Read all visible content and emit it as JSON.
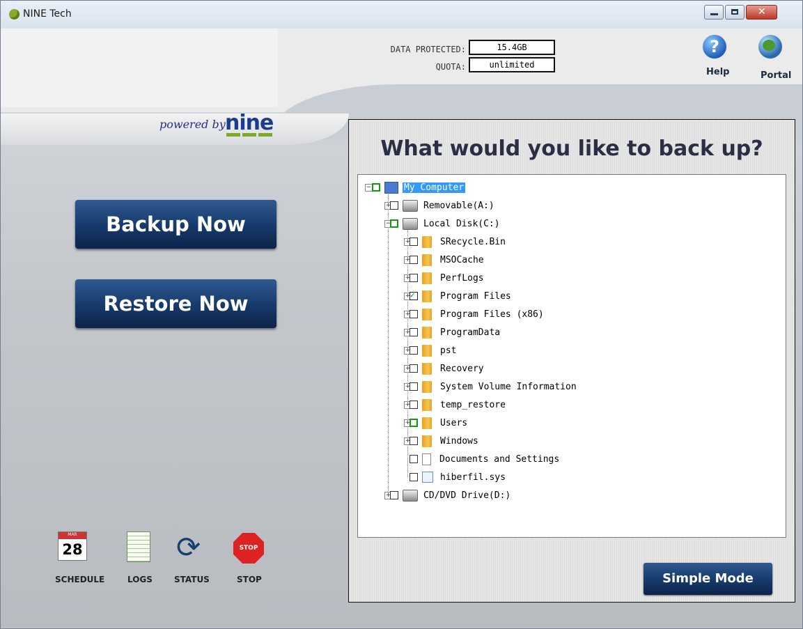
{
  "window": {
    "title": "NINE Tech",
    "close_glyph": "✕",
    "minimize_icon": "minimize-icon",
    "maximize_icon": "maximize-icon",
    "close_icon": "close-icon"
  },
  "header": {
    "powered_by": "powered by",
    "brand": "nine",
    "data_protected_label": "DATA PROTECTED:",
    "data_protected_value": "15.4GB",
    "quota_label": "QUOTA:",
    "quota_value": "unlimited",
    "help_label": "Help",
    "portal_label": "Portal",
    "help_glyph": "?",
    "help_icon": "help-icon",
    "portal_icon": "globe-icon"
  },
  "left": {
    "backup_label": "Backup Now",
    "restore_label": "Restore Now",
    "tools": [
      {
        "label": "SCHEDULE",
        "icon": "calendar-icon",
        "glyph_header": "MAR",
        "glyph_day": "28"
      },
      {
        "label": "LOGS",
        "icon": "logs-icon"
      },
      {
        "label": "STATUS",
        "icon": "refresh-icon",
        "glyph": "⟳"
      },
      {
        "label": "STOP",
        "icon": "stop-icon",
        "glyph": "STOP"
      }
    ]
  },
  "panel": {
    "title": "What would you like to back up?",
    "simple_mode_label": "Simple Mode",
    "tree": [
      {
        "label": "My Computer",
        "level": 0,
        "expander": "−",
        "check": "partial",
        "icon": "computer-icon",
        "selected": true
      },
      {
        "label": "Removable(A:)",
        "level": 1,
        "expander": "+",
        "check": "none",
        "icon": "removable-drive-icon"
      },
      {
        "label": "Local Disk(C:)",
        "level": 1,
        "expander": "−",
        "check": "partial",
        "icon": "local-disk-icon"
      },
      {
        "label": "SRecycle.Bin",
        "level": 2,
        "expander": "+",
        "check": "none",
        "icon": "folder-icon"
      },
      {
        "label": "MSOCache",
        "level": 2,
        "expander": "+",
        "check": "none",
        "icon": "folder-icon"
      },
      {
        "label": "PerfLogs",
        "level": 2,
        "expander": "+",
        "check": "none",
        "icon": "folder-icon"
      },
      {
        "label": "Program Files",
        "level": 2,
        "expander": "+",
        "check": "checked",
        "icon": "folder-icon"
      },
      {
        "label": "Program Files (x86)",
        "level": 2,
        "expander": "+",
        "check": "none",
        "icon": "folder-icon"
      },
      {
        "label": "ProgramData",
        "level": 2,
        "expander": "+",
        "check": "none",
        "icon": "folder-icon"
      },
      {
        "label": "pst",
        "level": 2,
        "expander": "+",
        "check": "none",
        "icon": "folder-icon"
      },
      {
        "label": "Recovery",
        "level": 2,
        "expander": "+",
        "check": "none",
        "icon": "folder-icon"
      },
      {
        "label": "System Volume Information",
        "level": 2,
        "expander": "+",
        "check": "none",
        "icon": "folder-icon"
      },
      {
        "label": "temp_restore",
        "level": 2,
        "expander": "+",
        "check": "none",
        "icon": "folder-icon"
      },
      {
        "label": "Users",
        "level": 2,
        "expander": "+",
        "check": "partial",
        "icon": "folder-icon"
      },
      {
        "label": "Windows",
        "level": 2,
        "expander": "+",
        "check": "none",
        "icon": "folder-icon"
      },
      {
        "label": "Documents and Settings",
        "level": 2,
        "expander": "",
        "check": "none",
        "icon": "file-icon"
      },
      {
        "label": "hiberfil.sys",
        "level": 2,
        "expander": "",
        "check": "none",
        "icon": "system-file-icon"
      },
      {
        "label": "CD/DVD Drive(D:)",
        "level": 1,
        "expander": "+",
        "check": "none",
        "icon": "cd-drive-icon"
      }
    ]
  }
}
